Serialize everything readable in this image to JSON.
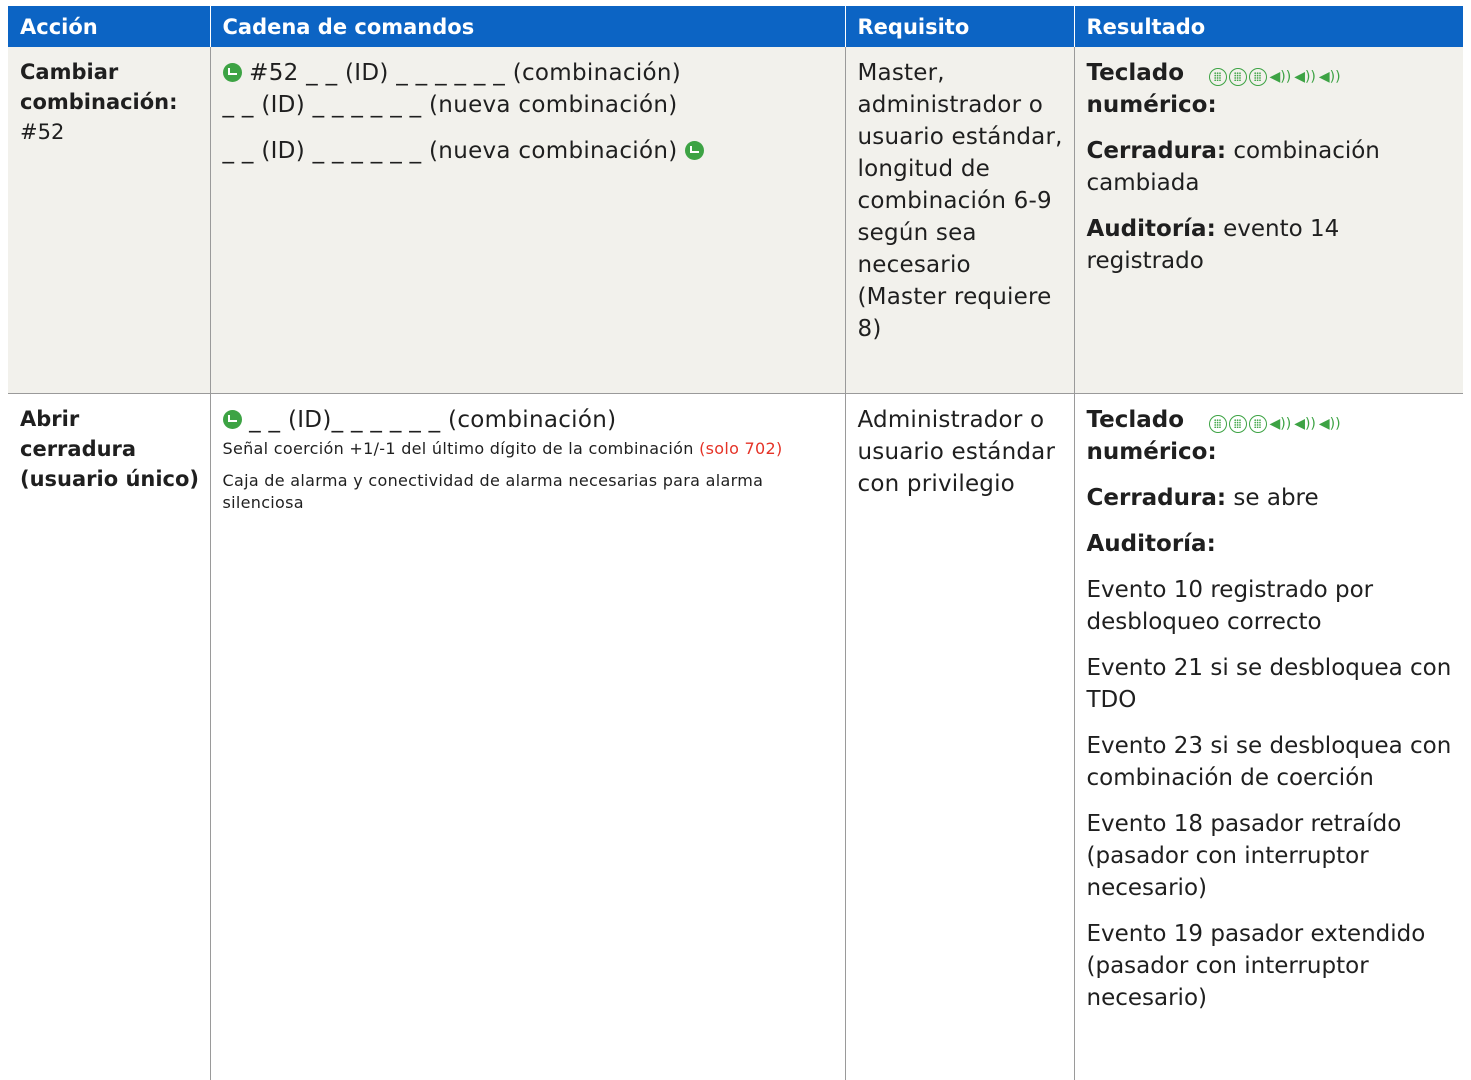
{
  "headers": [
    "Acción",
    "Cadena de comandos",
    "Requisito",
    "Resultado"
  ],
  "rows": [
    {
      "action_title": "Cambiar combinación:",
      "action_code": "#52",
      "command_lines": [
        "#52 _ _ (ID) _ _ _ _ _ _ (combinación)",
        "_ _ (ID) _ _ _ _ _ _ (nueva combinación)",
        "_ _ (ID) _ _ _ _ _ _ (nueva combinación)"
      ],
      "requirement": "Master, administrador o usuario estándar, longitud de combinación 6-9 según sea necesario (Master requiere 8)",
      "result": {
        "keypad_label": "Teclado numérico:",
        "lock_label": "Cerradura:",
        "lock_value": "combinación cambiada",
        "audit_label": "Auditoría:",
        "audit_value": "evento 14 registrado"
      }
    },
    {
      "action_title": "Abrir cerradura (usuario único)",
      "command_line": "_ _ (ID)_ _ _ _ _ _ (combinación)",
      "note1": "Señal coerción +1/-1 del último dígito de la combinación",
      "note1_red": "(solo 702)",
      "note2": "Caja de alarma y conectividad de alarma necesarias para alarma silenciosa",
      "requirement": "Administrador o usuario estándar con privilegio",
      "result": {
        "keypad_label": "Teclado numérico:",
        "lock_label": "Cerradura:",
        "lock_value": "se abre",
        "audit_label": "Auditoría:",
        "events": [
          "Evento 10 registrado por desbloqueo correcto",
          "Evento 21 si se desbloquea con TDO",
          "Evento 23 si se desbloquea con combinación de coerción",
          "Evento 18 pasador retraído (pasador con interruptor necesario)",
          "Evento 19 pasador extendido (pasador con interruptor necesario)"
        ]
      }
    }
  ],
  "icons": {
    "enter": "enter-key-icon",
    "keypad": "keypad-icon",
    "beep": "speaker-beep-icon"
  },
  "colors": {
    "header_bg": "#0c64c4",
    "row_shade": "#f2f1ec",
    "icon_green": "#3da344",
    "note_red": "#e53327"
  }
}
